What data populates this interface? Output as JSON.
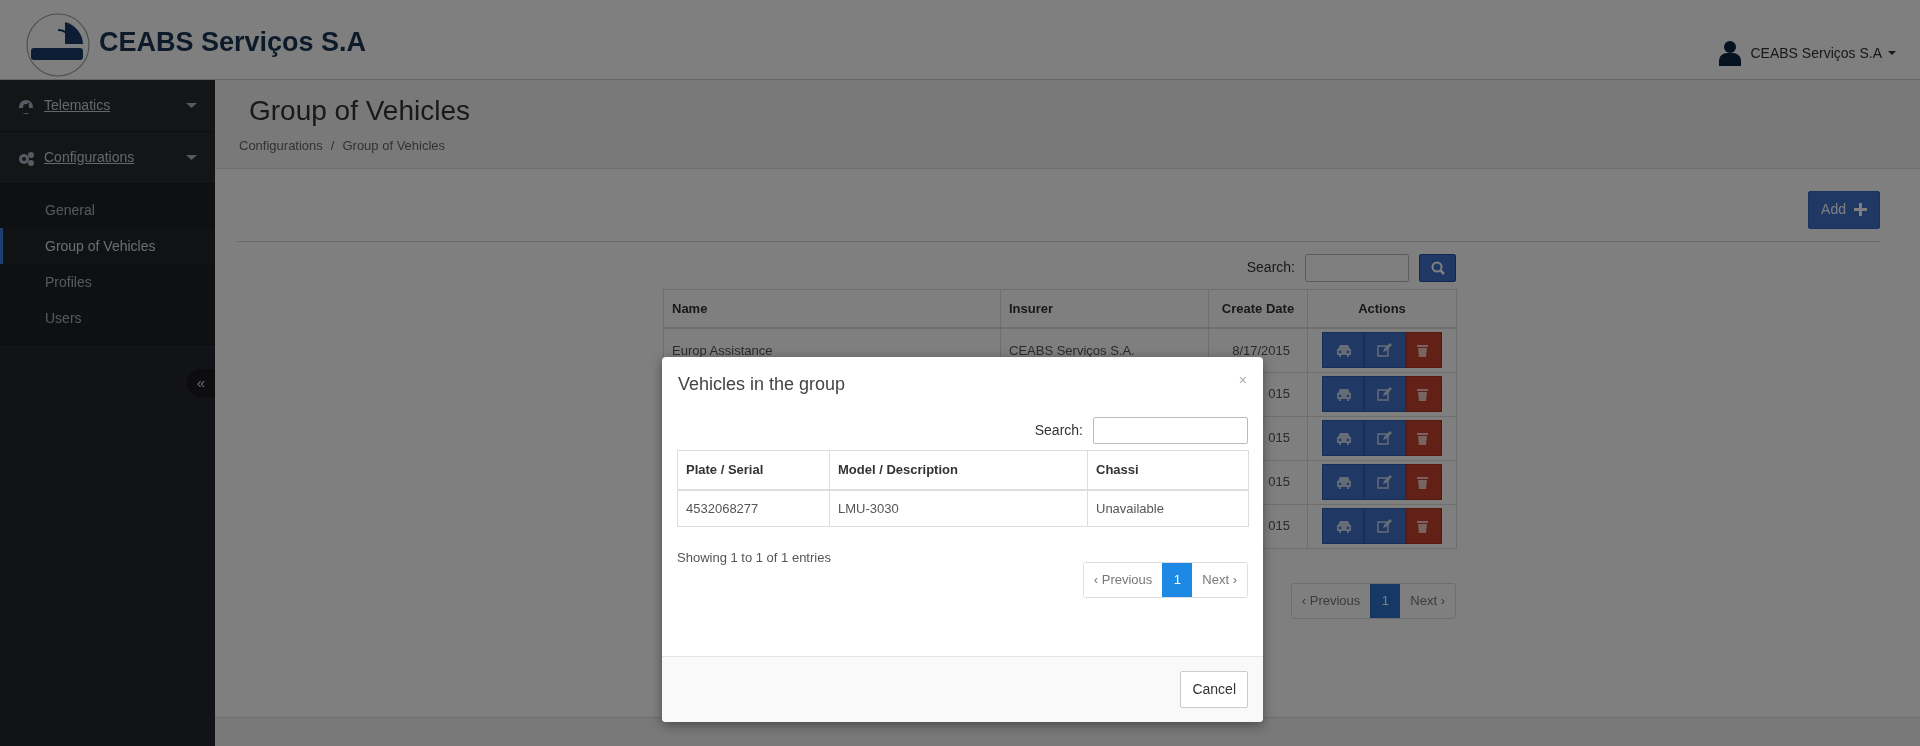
{
  "header": {
    "brand": "CEABS Serviços S.A",
    "user": "CEABS Serviços S.A"
  },
  "sidebar": {
    "items": [
      {
        "label": "Telematics"
      },
      {
        "label": "Configurations",
        "children": [
          {
            "label": "General",
            "selected": false
          },
          {
            "label": "Group of Vehicles",
            "selected": true
          },
          {
            "label": "Profiles",
            "selected": false
          },
          {
            "label": "Users",
            "selected": false
          }
        ]
      }
    ],
    "collapse_button": "«"
  },
  "page": {
    "title": "Group of Vehicles",
    "breadcrumb": [
      "Configurations",
      "/",
      "Group of Vehicles"
    ]
  },
  "add_button": "Add",
  "search": {
    "label": "Search:"
  },
  "table": {
    "columns": [
      "Name",
      "Insurer",
      "Create Date",
      "Actions"
    ],
    "rows": [
      {
        "name": "Europ Assistance",
        "insurer": "CEABS Serviços S.A.",
        "create_date": "8/17/2015"
      },
      {
        "create_date": "015"
      },
      {
        "create_date": "015"
      },
      {
        "create_date": "015"
      },
      {
        "create_date": "015"
      }
    ]
  },
  "pagination": {
    "previous": "‹ Previous",
    "next": "Next ›",
    "pages": [
      {
        "label": "1",
        "selected": true
      }
    ]
  },
  "modal": {
    "title": "Vehicles in the group",
    "close": "×",
    "search_label": "Search:",
    "columns": [
      "Plate / Serial",
      "Model / Description",
      "Chassi"
    ],
    "rows": [
      [
        "4532068277",
        "LMU-3030",
        "Unavailable"
      ]
    ],
    "info": "Showing 1 to 1 of 1 entries",
    "pagination": {
      "previous": "‹ Previous",
      "next": "Next ›",
      "pages": [
        {
          "label": "1",
          "selected": true
        }
      ]
    },
    "cancel": "Cancel"
  }
}
